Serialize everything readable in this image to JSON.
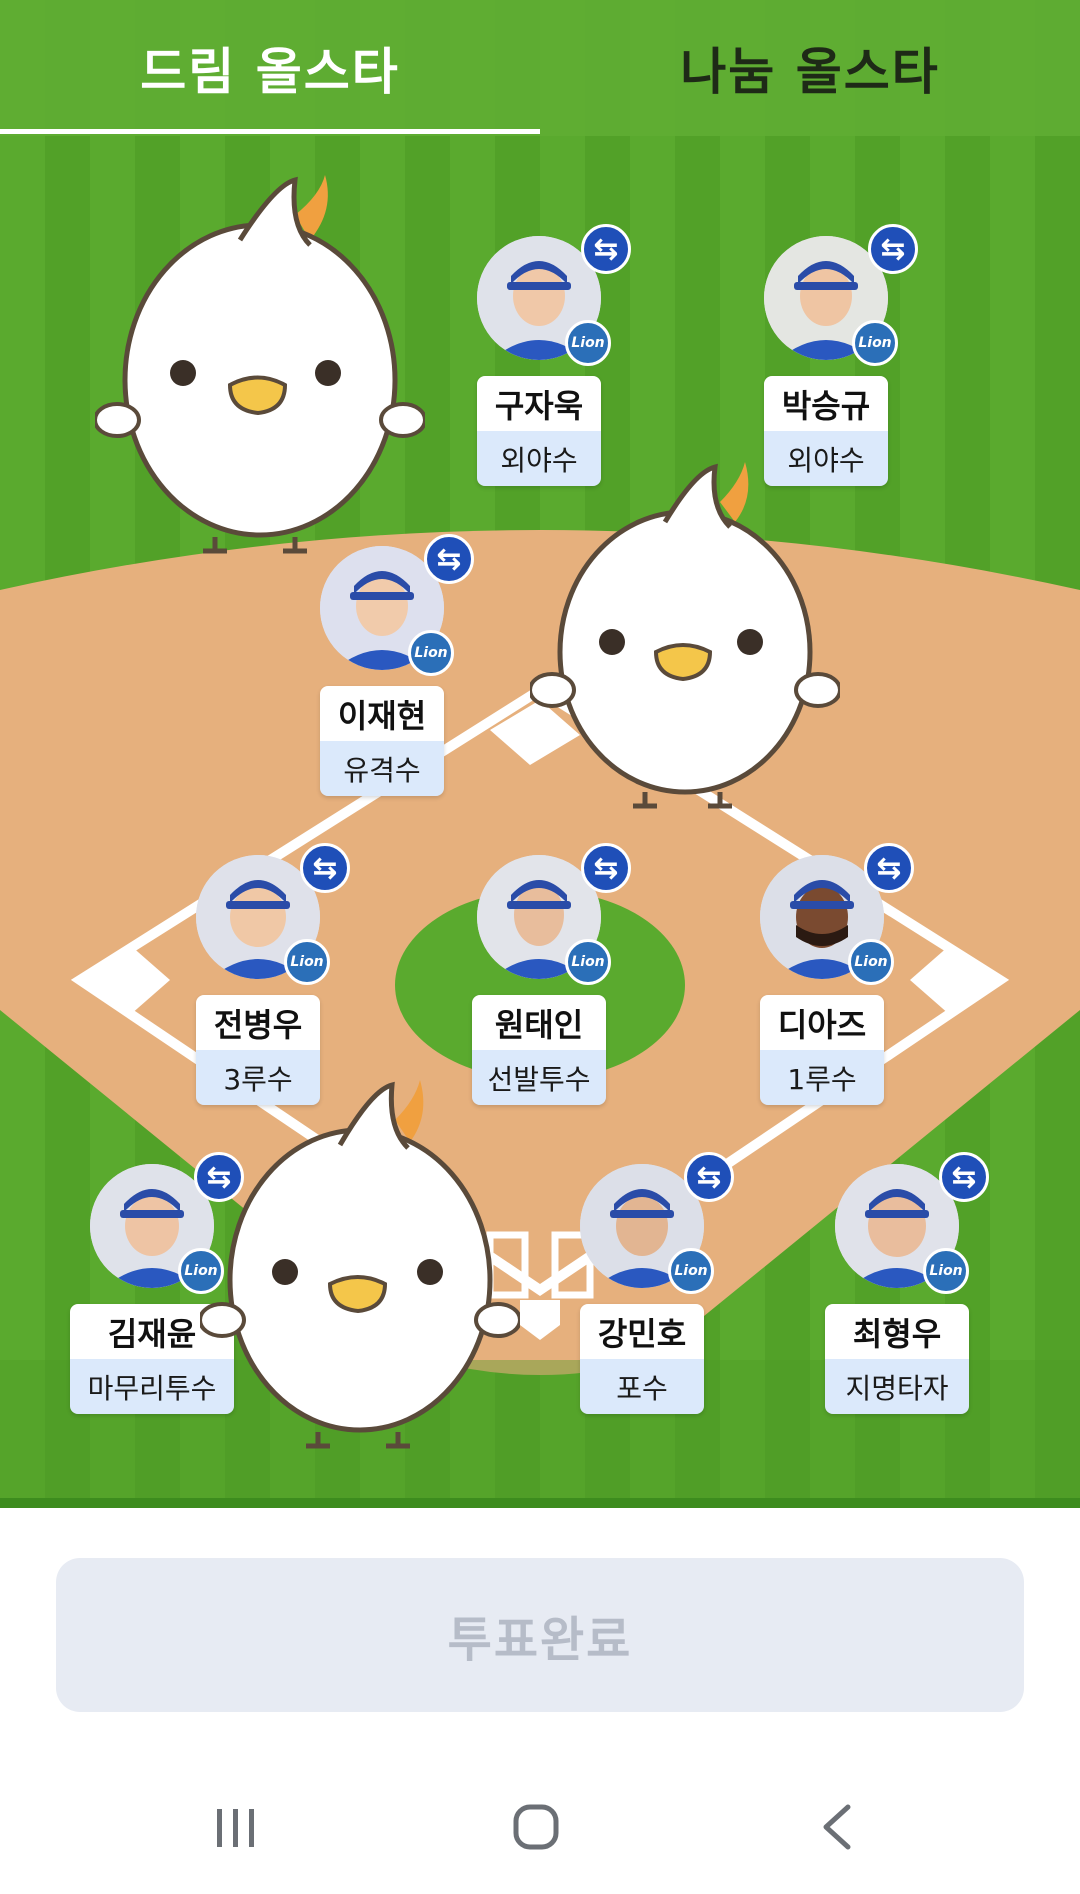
{
  "tabs": [
    {
      "label": "드림 올스타",
      "active": true
    },
    {
      "label": "나눔 올스타",
      "active": false
    }
  ],
  "players": [
    {
      "name": "구자욱",
      "position": "외야수"
    },
    {
      "name": "박승규",
      "position": "외야수"
    },
    {
      "name": "이재현",
      "position": "유격수"
    },
    {
      "name": "전병우",
      "position": "3루수"
    },
    {
      "name": "원태인",
      "position": "선발투수"
    },
    {
      "name": "디아즈",
      "position": "1루수"
    },
    {
      "name": "김재윤",
      "position": "마무리투수"
    },
    {
      "name": "강민호",
      "position": "포수"
    },
    {
      "name": "최형우",
      "position": "지명타자"
    }
  ],
  "vote_button": {
    "label": "투표완료",
    "state": "disabled"
  },
  "icons": {
    "swap": "swap-arrows-icon",
    "team": "lions-team-badge",
    "nav_recent": "recent-apps-icon",
    "nav_home": "home-icon",
    "nav_back": "back-icon"
  },
  "colors": {
    "field_green": "#5aaa2e",
    "infield_dirt": "#e6b07d",
    "swap_blue": "#1f4fb8",
    "position_bg": "#dbe9fb",
    "vote_button_bg": "#e7ebf3"
  }
}
